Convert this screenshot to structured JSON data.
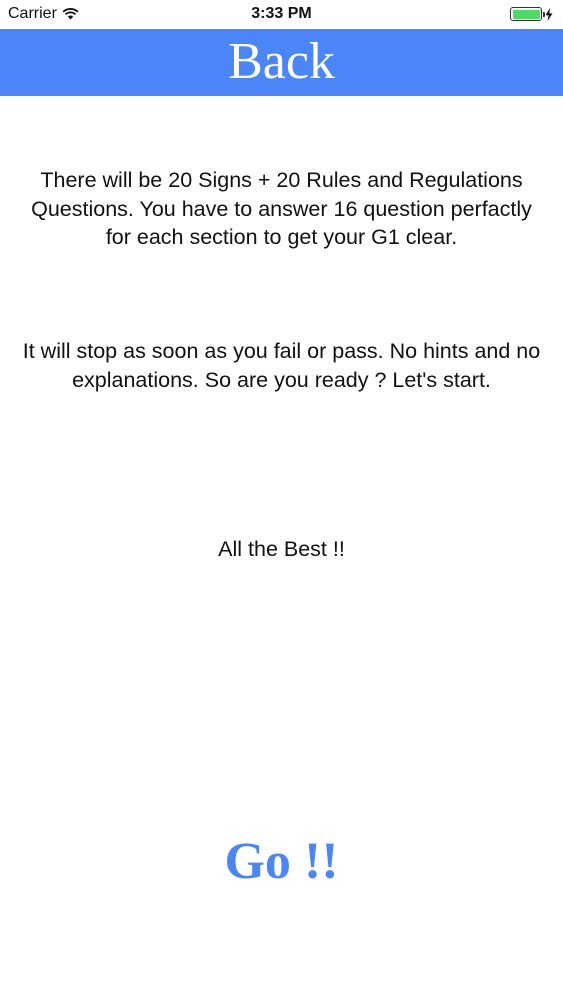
{
  "status_bar": {
    "carrier": "Carrier",
    "time": "3:33 PM",
    "wifi_icon": "wifi-icon",
    "battery_icon": "battery-icon",
    "charging_icon": "bolt-icon",
    "battery_level_percent": 100,
    "battery_color": "#4cd964"
  },
  "nav": {
    "back_label": "Back",
    "background_color": "#4a86f7"
  },
  "content": {
    "paragraph_1": "There will be 20 Signs + 20 Rules and Regulations Questions. You have to answer 16 question perfactly for each section to get your G1 clear.",
    "paragraph_2": "It will stop as soon as you fail or pass. No hints and no explanations. So are you ready ? Let's start.",
    "paragraph_3": "All the Best !!"
  },
  "go_button": {
    "label": "Go !!",
    "color": "#4a86f7"
  }
}
